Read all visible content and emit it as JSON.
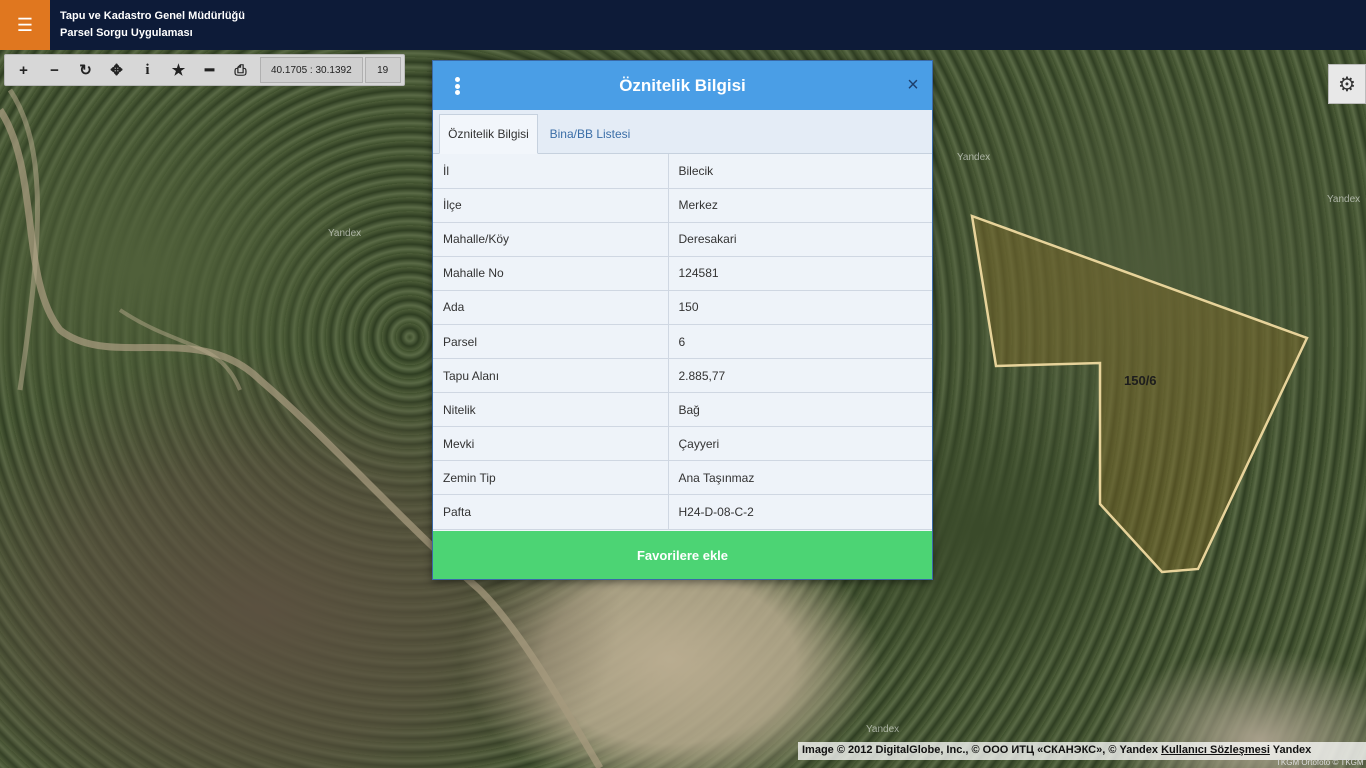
{
  "header": {
    "menu_icon": "hamburger-icon",
    "title_line1": "Tapu ve Kadastro Genel Müdürlüğü",
    "title_line2": "Parsel Sorgu Uygulaması"
  },
  "toolbar": {
    "coordinates": "40.1705 : 30.1392",
    "zoom_level": "19",
    "tools": [
      "zoom-in-icon",
      "zoom-out-icon",
      "refresh-icon",
      "locate-icon",
      "info-icon",
      "star-icon",
      "measure-icon",
      "print-icon"
    ]
  },
  "map": {
    "parcel_label": "150/6",
    "watermarks": [
      "Yandex",
      "Yandex",
      "Yandex",
      "Yandex"
    ],
    "attribution_text": "Image © 2012 DigitalGlobe, Inc., © ООО ИТЦ «СКАНЭКС», © Yandex ",
    "attribution_link": "Kullanıcı Sözleşmesi",
    "attribution_suffix": " Yandex",
    "tkgm_credit": "TKGM Ortofoto © TKGM",
    "parcel_color": "#e7d39a"
  },
  "dialog": {
    "title": "Öznitelik Bilgisi",
    "close_symbol": "×",
    "tabs": [
      {
        "label": "Öznitelik Bilgisi",
        "active": true
      },
      {
        "label": "Bina/BB Listesi",
        "active": false
      }
    ],
    "rows": [
      {
        "key": "İl",
        "value": "Bilecik"
      },
      {
        "key": "İlçe",
        "value": "Merkez"
      },
      {
        "key": "Mahalle/Köy",
        "value": "Deresakari"
      },
      {
        "key": "Mahalle No",
        "value": "124581"
      },
      {
        "key": "Ada",
        "value": "150"
      },
      {
        "key": "Parsel",
        "value": "6"
      },
      {
        "key": "Tapu Alanı",
        "value": "2.885,77"
      },
      {
        "key": "Nitelik",
        "value": "Bağ"
      },
      {
        "key": "Mevki",
        "value": "Çayyeri"
      },
      {
        "key": "Zemin Tip",
        "value": "Ana Taşınmaz"
      },
      {
        "key": "Pafta",
        "value": "H24-D-08-C-2"
      }
    ],
    "favorite_button": "Favorilere ekle"
  },
  "colors": {
    "topbar": "#0d1b38",
    "menu_button": "#e0771f",
    "dialog_header": "#4a9ee6",
    "favorite_button": "#4cd474"
  }
}
